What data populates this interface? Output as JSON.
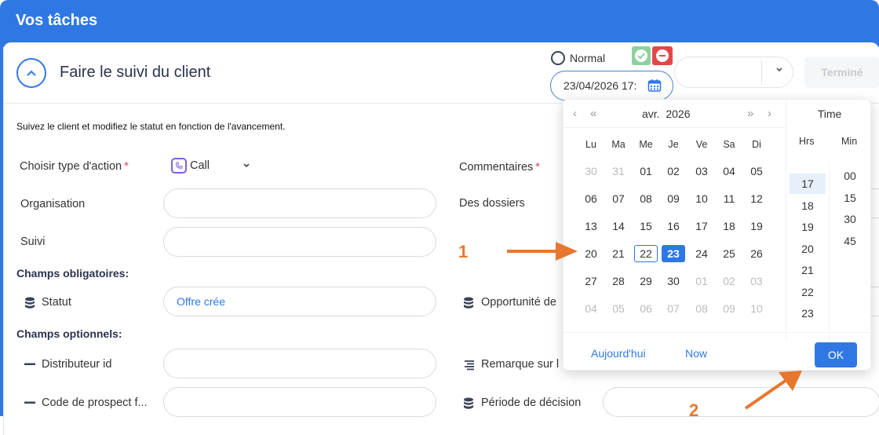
{
  "window": {
    "title": "Vos tâches"
  },
  "task": {
    "title": "Faire le suivi du client",
    "description": "Suivez le client et modifiez le statut en fonction de l'avancement."
  },
  "priority": {
    "label": "Normal"
  },
  "date_input": {
    "value": "23/04/2026 17:"
  },
  "buttons": {
    "termine": "Terminé",
    "ok": "OK",
    "today": "Aujourd'hui",
    "now": "Now"
  },
  "form": {
    "action_type_label": "Choisir type d'action",
    "action_type_value": "Call",
    "required_star": "*",
    "organisation_label": "Organisation",
    "suivi_label": "Suivi",
    "section_required": "Champs obligatoires:",
    "statut_label": "Statut",
    "statut_value": "Offre crée",
    "section_optional": "Champs optionnels:",
    "distributeur_label": "Distributeur id",
    "code_prospect_label": "Code de prospect f...",
    "commentaires_label": "Commentaires",
    "dossiers_label": "Des dossiers",
    "opportunite_label": "Opportunité de",
    "remarque_label": "Remarque sur l",
    "periode_label": "Période de décision"
  },
  "calendar": {
    "month": "avr.",
    "year": "2026",
    "nav_prev": "‹",
    "nav_prev_year": "«",
    "nav_next_year": "»",
    "nav_next": "›",
    "weekdays": [
      "Lu",
      "Ma",
      "Me",
      "Je",
      "Ve",
      "Sa",
      "Di"
    ],
    "weeks": [
      [
        "30",
        "31",
        "01",
        "02",
        "03",
        "04",
        "05"
      ],
      [
        "06",
        "07",
        "08",
        "09",
        "10",
        "11",
        "12"
      ],
      [
        "13",
        "14",
        "15",
        "16",
        "17",
        "18",
        "19"
      ],
      [
        "20",
        "21",
        "22",
        "23",
        "24",
        "25",
        "26"
      ],
      [
        "27",
        "28",
        "29",
        "30",
        "01",
        "02",
        "03"
      ],
      [
        "04",
        "05",
        "06",
        "07",
        "08",
        "09",
        "10"
      ]
    ],
    "today": "22",
    "selected": "23"
  },
  "time": {
    "title": "Time",
    "hours_label": "Hrs",
    "minutes_label": "Min",
    "hours": [
      "17",
      "18",
      "19",
      "20",
      "21",
      "22",
      "23"
    ],
    "selected_hour": "17",
    "minutes": [
      "00",
      "15",
      "30",
      "45"
    ]
  },
  "annotations": {
    "one": "1",
    "two": "2"
  },
  "colors": {
    "primary": "#2f78e4",
    "accent": "#e8772e",
    "danger": "#e24848",
    "success": "#8fd19e"
  }
}
